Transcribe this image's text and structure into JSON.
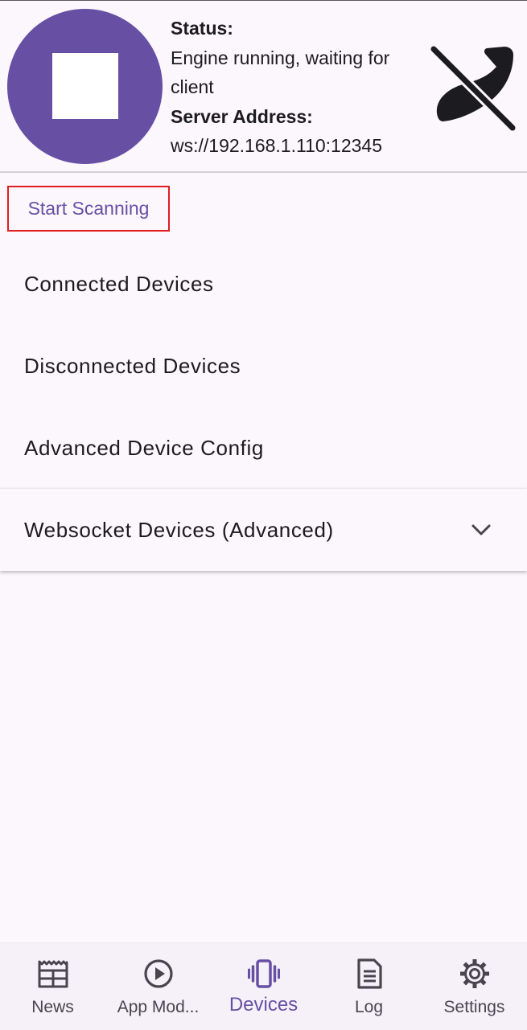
{
  "status": {
    "status_label": "Status:",
    "status_value_line1": "Engine running, waiting for",
    "status_value_line2": "client",
    "address_label": "Server Address:",
    "address_value": "ws://192.168.1.110:12345"
  },
  "engine_button": {
    "icon": "stop-icon",
    "color": "#6750a4"
  },
  "client_indicator": {
    "icon": "phone-disabled-icon"
  },
  "scan_button": {
    "label": "Start Scanning"
  },
  "device_sections": [
    {
      "label": "Connected Devices"
    },
    {
      "label": "Disconnected Devices"
    },
    {
      "label": "Advanced Device Config"
    },
    {
      "label": "Websocket Devices (Advanced)",
      "expandable": true,
      "expanded": false,
      "icon": "chevron-down-icon"
    }
  ],
  "bottom_nav": {
    "active": "Devices",
    "items": [
      {
        "label": "News",
        "icon": "news-icon"
      },
      {
        "label": "App Mod...",
        "icon": "play-circle-icon"
      },
      {
        "label": "Devices",
        "icon": "vibration-icon"
      },
      {
        "label": "Log",
        "icon": "document-icon"
      },
      {
        "label": "Settings",
        "icon": "gear-icon"
      }
    ]
  },
  "colors": {
    "primary": "#6750a4",
    "background": "#fcf7fd",
    "highlight_border": "#e01e22",
    "nav_background": "#f6f0f8"
  }
}
